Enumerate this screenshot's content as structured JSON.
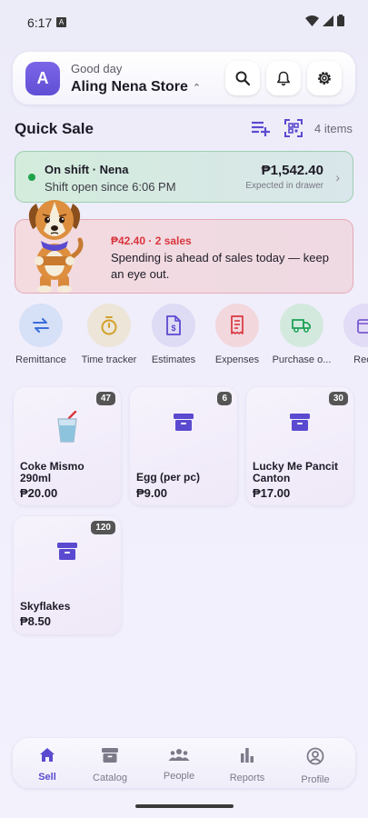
{
  "status_bar": {
    "time": "6:17",
    "notif_icon": "A"
  },
  "header": {
    "avatar_letter": "A",
    "greeting": "Good day",
    "store_name": "Aling Nena Store",
    "icons": [
      "search-icon",
      "bell-icon",
      "gear-icon"
    ]
  },
  "quick_sale": {
    "title": "Quick Sale",
    "item_count": "4 items"
  },
  "shift": {
    "title": "On shift · Nena",
    "subtitle": "Shift open since 6:06 PM",
    "amount": "₱1,542.40",
    "amount_label": "Expected in drawer"
  },
  "alert": {
    "amount": "₱42.40 · 2 sales",
    "message": "Spending is ahead of sales today — keep an eye out."
  },
  "actions": [
    {
      "label": "Remittance",
      "icon": "transfer-icon",
      "color": "#3b6fd8"
    },
    {
      "label": "Time tracker",
      "icon": "stopwatch-icon",
      "color": "#d3a02a"
    },
    {
      "label": "Estimates",
      "icon": "document-dollar-icon",
      "color": "#5a4ad0"
    },
    {
      "label": "Expenses",
      "icon": "receipt-icon",
      "color": "#d9363e"
    },
    {
      "label": "Purchase o...",
      "icon": "truck-icon",
      "color": "#21a15a"
    },
    {
      "label": "Recu",
      "icon": "calendar-icon",
      "color": "#7a5ad0"
    }
  ],
  "products": [
    {
      "name": "Coke Mismo 290ml",
      "price": "₱20.00",
      "stock": "47",
      "icon": "drink-cup-icon"
    },
    {
      "name": "Egg (per pc)",
      "price": "₱9.00",
      "stock": "6",
      "icon": "box-icon"
    },
    {
      "name": "Lucky Me Pancit Canton",
      "price": "₱17.00",
      "stock": "30",
      "icon": "box-icon"
    },
    {
      "name": "Skyflakes",
      "price": "₱8.50",
      "stock": "120",
      "icon": "box-icon"
    }
  ],
  "nav": [
    {
      "label": "Sell",
      "icon": "home-icon",
      "active": true
    },
    {
      "label": "Catalog",
      "icon": "catalog-box-icon",
      "active": false
    },
    {
      "label": "People",
      "icon": "people-icon",
      "active": false
    },
    {
      "label": "Reports",
      "icon": "bar-chart-icon",
      "active": false
    },
    {
      "label": "Profile",
      "icon": "profile-icon",
      "active": false
    }
  ],
  "colors": {
    "accent": "#5a4ad0",
    "warning": "#d9363e",
    "success": "#1fa34a"
  }
}
